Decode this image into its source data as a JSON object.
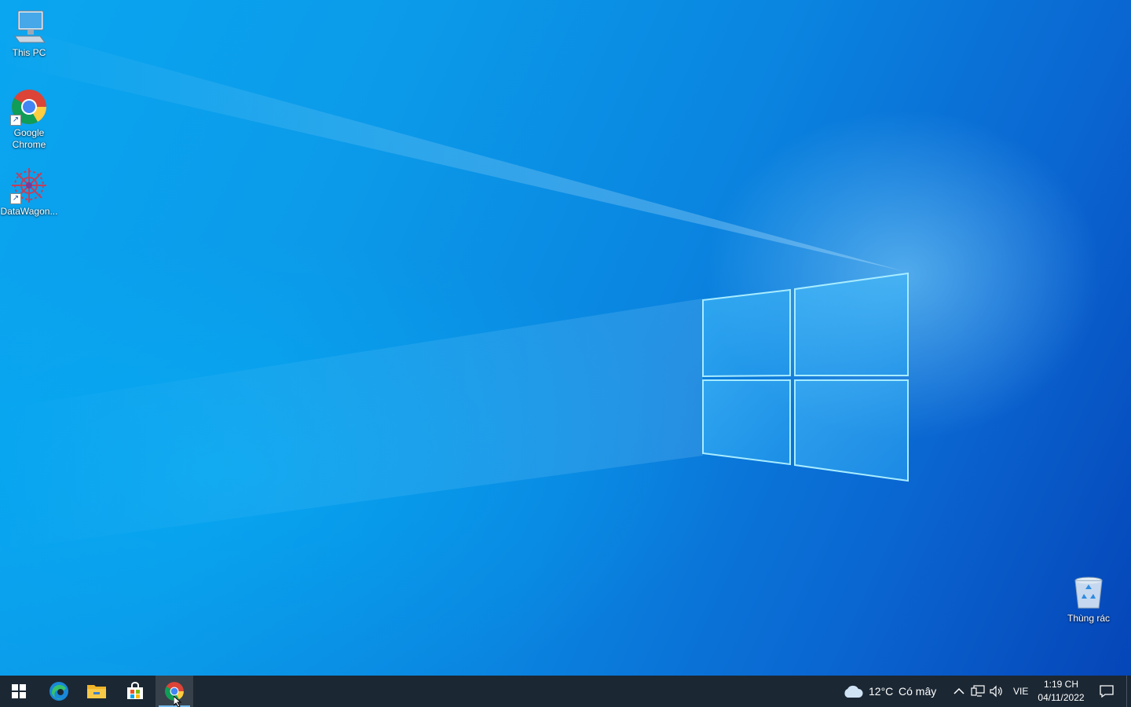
{
  "desktop": {
    "icons": [
      {
        "label": "This PC",
        "icon": "this-pc-icon"
      },
      {
        "label": "Google\nChrome",
        "icon": "chrome-icon"
      },
      {
        "label": "DataWagon...",
        "icon": "datawagon-icon"
      },
      {
        "label": "Thùng rác",
        "icon": "recycle-bin-icon"
      }
    ]
  },
  "taskbar": {
    "apps": [
      {
        "name": "Start",
        "icon": "windows-start-icon"
      },
      {
        "name": "Microsoft Edge",
        "icon": "edge-icon"
      },
      {
        "name": "File Explorer",
        "icon": "folder-icon"
      },
      {
        "name": "Microsoft Store",
        "icon": "store-icon"
      },
      {
        "name": "Google Chrome",
        "icon": "chrome-icon",
        "active": true
      }
    ],
    "weather": {
      "temp": "12°C",
      "condition": "Có mây",
      "icon": "cloud-icon"
    },
    "tray": {
      "language": "VIE",
      "icons": [
        "chevron-up-icon",
        "network-icon",
        "volume-icon"
      ]
    },
    "clock": {
      "time": "1:19 CH",
      "date": "04/11/2022"
    },
    "notification_icon": "action-center-icon"
  },
  "colors": {
    "taskbar_bg": "#1b2733",
    "desktop_blue": "#0a85e0",
    "accent": "#76b9ed"
  }
}
